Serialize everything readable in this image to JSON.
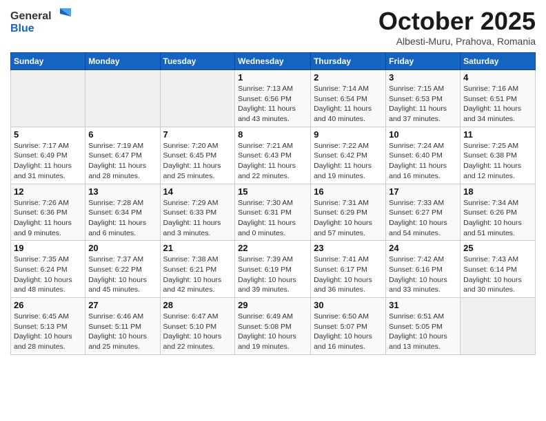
{
  "header": {
    "logo_general": "General",
    "logo_blue": "Blue",
    "month_title": "October 2025",
    "subtitle": "Albesti-Muru, Prahova, Romania"
  },
  "days_of_week": [
    "Sunday",
    "Monday",
    "Tuesday",
    "Wednesday",
    "Thursday",
    "Friday",
    "Saturday"
  ],
  "weeks": [
    [
      {
        "day": "",
        "info": ""
      },
      {
        "day": "",
        "info": ""
      },
      {
        "day": "",
        "info": ""
      },
      {
        "day": "1",
        "info": "Sunrise: 7:13 AM\nSunset: 6:56 PM\nDaylight: 11 hours and 43 minutes."
      },
      {
        "day": "2",
        "info": "Sunrise: 7:14 AM\nSunset: 6:54 PM\nDaylight: 11 hours and 40 minutes."
      },
      {
        "day": "3",
        "info": "Sunrise: 7:15 AM\nSunset: 6:53 PM\nDaylight: 11 hours and 37 minutes."
      },
      {
        "day": "4",
        "info": "Sunrise: 7:16 AM\nSunset: 6:51 PM\nDaylight: 11 hours and 34 minutes."
      }
    ],
    [
      {
        "day": "5",
        "info": "Sunrise: 7:17 AM\nSunset: 6:49 PM\nDaylight: 11 hours and 31 minutes."
      },
      {
        "day": "6",
        "info": "Sunrise: 7:19 AM\nSunset: 6:47 PM\nDaylight: 11 hours and 28 minutes."
      },
      {
        "day": "7",
        "info": "Sunrise: 7:20 AM\nSunset: 6:45 PM\nDaylight: 11 hours and 25 minutes."
      },
      {
        "day": "8",
        "info": "Sunrise: 7:21 AM\nSunset: 6:43 PM\nDaylight: 11 hours and 22 minutes."
      },
      {
        "day": "9",
        "info": "Sunrise: 7:22 AM\nSunset: 6:42 PM\nDaylight: 11 hours and 19 minutes."
      },
      {
        "day": "10",
        "info": "Sunrise: 7:24 AM\nSunset: 6:40 PM\nDaylight: 11 hours and 16 minutes."
      },
      {
        "day": "11",
        "info": "Sunrise: 7:25 AM\nSunset: 6:38 PM\nDaylight: 11 hours and 12 minutes."
      }
    ],
    [
      {
        "day": "12",
        "info": "Sunrise: 7:26 AM\nSunset: 6:36 PM\nDaylight: 11 hours and 9 minutes."
      },
      {
        "day": "13",
        "info": "Sunrise: 7:28 AM\nSunset: 6:34 PM\nDaylight: 11 hours and 6 minutes."
      },
      {
        "day": "14",
        "info": "Sunrise: 7:29 AM\nSunset: 6:33 PM\nDaylight: 11 hours and 3 minutes."
      },
      {
        "day": "15",
        "info": "Sunrise: 7:30 AM\nSunset: 6:31 PM\nDaylight: 11 hours and 0 minutes."
      },
      {
        "day": "16",
        "info": "Sunrise: 7:31 AM\nSunset: 6:29 PM\nDaylight: 10 hours and 57 minutes."
      },
      {
        "day": "17",
        "info": "Sunrise: 7:33 AM\nSunset: 6:27 PM\nDaylight: 10 hours and 54 minutes."
      },
      {
        "day": "18",
        "info": "Sunrise: 7:34 AM\nSunset: 6:26 PM\nDaylight: 10 hours and 51 minutes."
      }
    ],
    [
      {
        "day": "19",
        "info": "Sunrise: 7:35 AM\nSunset: 6:24 PM\nDaylight: 10 hours and 48 minutes."
      },
      {
        "day": "20",
        "info": "Sunrise: 7:37 AM\nSunset: 6:22 PM\nDaylight: 10 hours and 45 minutes."
      },
      {
        "day": "21",
        "info": "Sunrise: 7:38 AM\nSunset: 6:21 PM\nDaylight: 10 hours and 42 minutes."
      },
      {
        "day": "22",
        "info": "Sunrise: 7:39 AM\nSunset: 6:19 PM\nDaylight: 10 hours and 39 minutes."
      },
      {
        "day": "23",
        "info": "Sunrise: 7:41 AM\nSunset: 6:17 PM\nDaylight: 10 hours and 36 minutes."
      },
      {
        "day": "24",
        "info": "Sunrise: 7:42 AM\nSunset: 6:16 PM\nDaylight: 10 hours and 33 minutes."
      },
      {
        "day": "25",
        "info": "Sunrise: 7:43 AM\nSunset: 6:14 PM\nDaylight: 10 hours and 30 minutes."
      }
    ],
    [
      {
        "day": "26",
        "info": "Sunrise: 6:45 AM\nSunset: 5:13 PM\nDaylight: 10 hours and 28 minutes."
      },
      {
        "day": "27",
        "info": "Sunrise: 6:46 AM\nSunset: 5:11 PM\nDaylight: 10 hours and 25 minutes."
      },
      {
        "day": "28",
        "info": "Sunrise: 6:47 AM\nSunset: 5:10 PM\nDaylight: 10 hours and 22 minutes."
      },
      {
        "day": "29",
        "info": "Sunrise: 6:49 AM\nSunset: 5:08 PM\nDaylight: 10 hours and 19 minutes."
      },
      {
        "day": "30",
        "info": "Sunrise: 6:50 AM\nSunset: 5:07 PM\nDaylight: 10 hours and 16 minutes."
      },
      {
        "day": "31",
        "info": "Sunrise: 6:51 AM\nSunset: 5:05 PM\nDaylight: 10 hours and 13 minutes."
      },
      {
        "day": "",
        "info": ""
      }
    ]
  ]
}
